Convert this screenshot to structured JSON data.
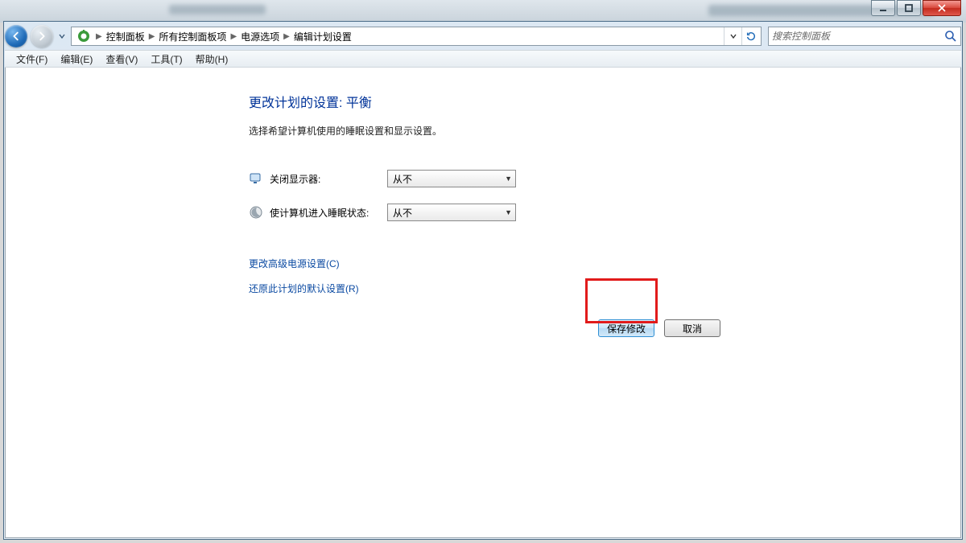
{
  "window_controls": {
    "minimize": "min",
    "maximize": "max",
    "close": "close"
  },
  "breadcrumb": {
    "items": [
      "控制面板",
      "所有控制面板项",
      "电源选项",
      "编辑计划设置"
    ]
  },
  "search": {
    "placeholder": "搜索控制面板"
  },
  "menubar": {
    "file": "文件(F)",
    "edit": "编辑(E)",
    "view": "查看(V)",
    "tools": "工具(T)",
    "help": "帮助(H)"
  },
  "page": {
    "title": "更改计划的设置: 平衡",
    "subtitle": "选择希望计算机使用的睡眠设置和显示设置。"
  },
  "settings": {
    "display_off": {
      "label": "关闭显示器:",
      "value": "从不"
    },
    "sleep": {
      "label": "使计算机进入睡眠状态:",
      "value": "从不"
    }
  },
  "links": {
    "advanced": "更改高级电源设置(C)",
    "restore": "还原此计划的默认设置(R)"
  },
  "buttons": {
    "save": "保存修改",
    "cancel": "取消"
  }
}
